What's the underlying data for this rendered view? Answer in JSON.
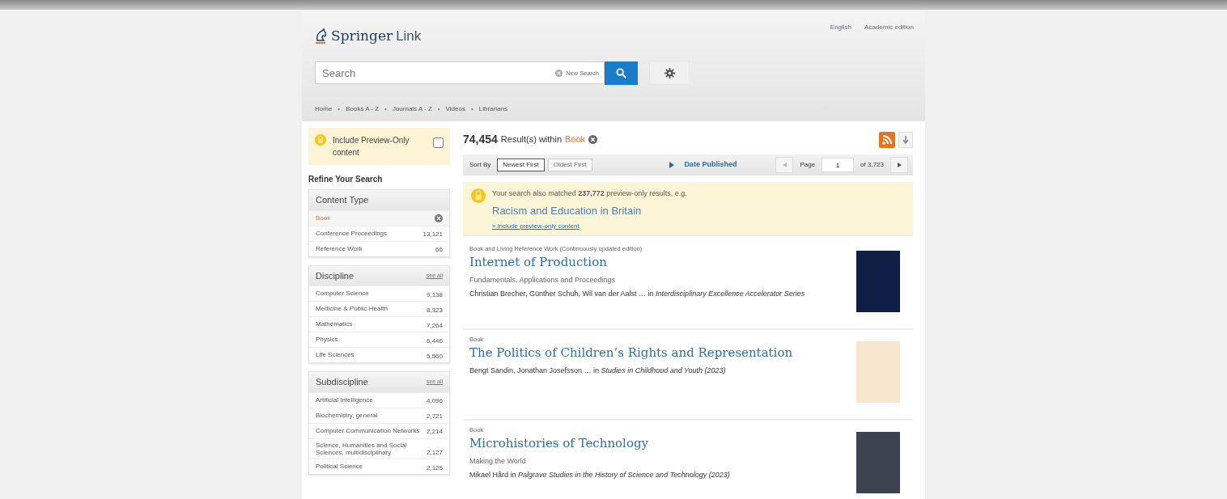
{
  "header": {
    "logo": {
      "brand": "Springer",
      "product": "Link"
    },
    "language": "English",
    "edition": "Academic edition",
    "search": {
      "placeholder": "Search"
    },
    "new_search": "New Search",
    "nav_separator": "•",
    "nav": [
      "Home",
      "Books A - Z",
      "Journals A - Z",
      "Videos",
      "Librarians"
    ]
  },
  "preview_toggle": {
    "label": "Include Preview-Only content",
    "checked": false
  },
  "refine_title": "Refine Your Search",
  "facets": [
    {
      "title": "Content Type",
      "items": [
        {
          "label": "Book",
          "selected": true
        },
        {
          "label": "Conference Proceedings",
          "count": "13,121",
          "selected": false
        },
        {
          "label": "Reference Work",
          "count": "66",
          "selected": false
        }
      ]
    },
    {
      "title": "Discipline",
      "see_all": "see all",
      "items": [
        {
          "label": "Computer Science",
          "count": "9,138",
          "selected": false
        },
        {
          "label": "Medicine & Public Health",
          "count": "8,323",
          "selected": false
        },
        {
          "label": "Mathematics",
          "count": "7,264",
          "selected": false
        },
        {
          "label": "Physics",
          "count": "6,446",
          "selected": false
        },
        {
          "label": "Life Sciences",
          "count": "5,560",
          "selected": false
        }
      ]
    },
    {
      "title": "Subdiscipline",
      "see_all": "see all",
      "items": [
        {
          "label": "Artificial Intelligence",
          "count": "4,096",
          "selected": false
        },
        {
          "label": "Biochemistry, general",
          "count": "2,721",
          "selected": false
        },
        {
          "label": "Computer Communication Networks",
          "count": "2,214",
          "selected": false
        },
        {
          "label": "Science, Humanities and Social Sciences, multidisciplinary",
          "count": "2,127",
          "selected": false
        },
        {
          "label": "Political Science",
          "count": "2,125",
          "selected": false
        }
      ]
    }
  ],
  "results_header": {
    "count": "74,454",
    "text": "Result(s) within",
    "filter": "Book"
  },
  "sort": {
    "label": "Sort By",
    "options": [
      {
        "label": "Newest First",
        "selected": true
      },
      {
        "label": "Oldest First",
        "selected": false
      }
    ],
    "date": "Date Published",
    "page_label": "Page",
    "page": "1",
    "of": "of 3,723"
  },
  "preview_notice": {
    "text": "Your search also matched **237,772** preview-only results, e.g.",
    "title": "Racism and Education in Britain",
    "link": "» include preview-only content"
  },
  "results": [
    {
      "type": "Book and Living Reference Work (Continuously updated edition)",
      "title": "Internet of Production",
      "subtitle": "Fundamentals, Applications and Proceedings",
      "authors": "Christian Brecher, Günther Schuh, Wil van der Aalst … in *Interdisciplinary Excellence Accelerator Series*",
      "color": "#0f1e45"
    },
    {
      "type": "Book",
      "title": "The Politics of Children’s Rights and Representation",
      "authors": "Bengt Sandin, Jonathan Josefsson … in *Studies in Childhood and Youth (2023)*",
      "color": "#f7e7cf"
    },
    {
      "type": "Book",
      "title": "Microhistories of Technology",
      "subtitle": "Making the World",
      "authors": "Mikael Hård in *Palgrave Studies in the History of Science and Technology (2023)*",
      "color": "#3a434e"
    }
  ]
}
